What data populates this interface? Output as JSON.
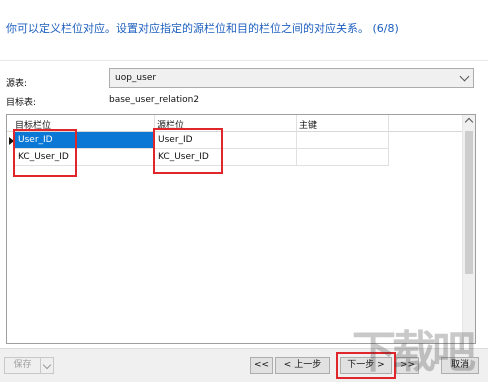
{
  "heading": "你可以定义栏位对应。设置对应指定的源栏位和目的栏位之间的对应关系。 (6/8)",
  "source": {
    "label": "源表:",
    "value": "uop_user"
  },
  "target": {
    "label": "目标表:",
    "value": "base_user_relation2"
  },
  "grid": {
    "columns": [
      "目标栏位",
      "源栏位",
      "主键"
    ],
    "rows": [
      {
        "target": "User_ID",
        "source": "User_ID",
        "key": ""
      },
      {
        "target": "KC_User_ID",
        "source": "KC_User_ID",
        "key": ""
      }
    ]
  },
  "footer": {
    "save": "保存",
    "first": "<<",
    "prev": "< 上一步",
    "next": "下一步 >",
    "last": ">>",
    "cancel": "取消"
  },
  "watermark": "下载吧",
  "colors": {
    "heading": "#1d5fbf",
    "selection": "#0a78d4",
    "highlight_box": "#e0262b"
  }
}
